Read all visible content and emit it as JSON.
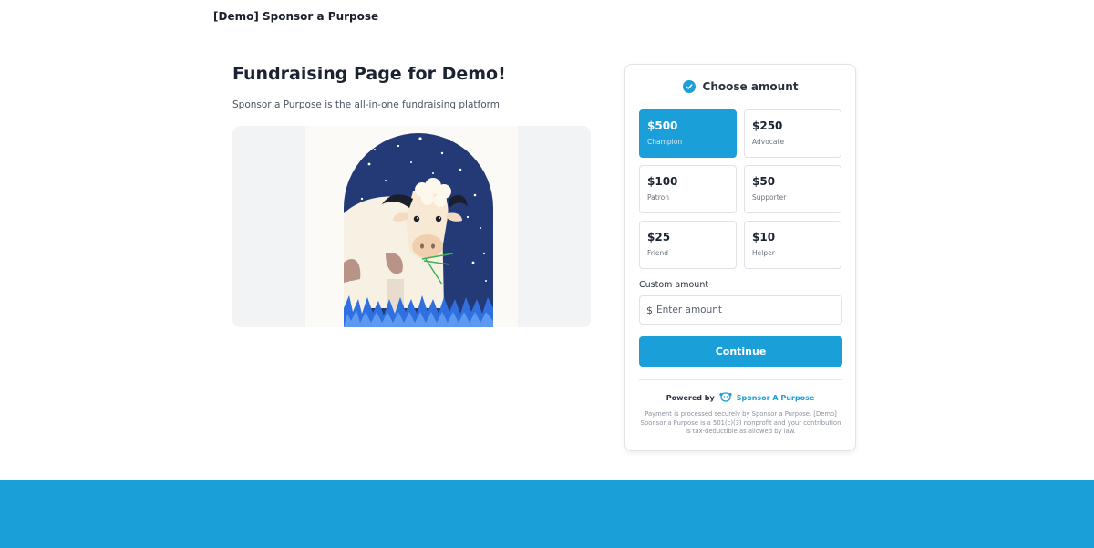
{
  "header": {
    "site_title": "[Demo] Sponsor a Purpose"
  },
  "main": {
    "title": "Fundraising Page for Demo!",
    "subtitle": "Sponsor a Purpose is the all-in-one fundraising platform",
    "image_subject": "illustrated cow grazing under a starry night sky"
  },
  "donation": {
    "heading": "Choose amount",
    "tiers": [
      {
        "amount": "$500",
        "name": "Champion",
        "selected": true
      },
      {
        "amount": "$250",
        "name": "Advocate",
        "selected": false
      },
      {
        "amount": "$100",
        "name": "Patron",
        "selected": false
      },
      {
        "amount": "$50",
        "name": "Supporter",
        "selected": false
      },
      {
        "amount": "$25",
        "name": "Friend",
        "selected": false
      },
      {
        "amount": "$10",
        "name": "Helper",
        "selected": false
      }
    ],
    "custom_label": "Custom amount",
    "currency_symbol": "$",
    "custom_placeholder": "Enter amount",
    "continue_label": "Continue",
    "powered_by": "Powered by",
    "brand": "Sponsor A Purpose",
    "legal": "Payment is processed securely by Sponsor a Purpose. [Demo] Sponsor a Purpose is a 501(c)(3) nonprofit and your contribution is tax-deductible as allowed by law."
  },
  "colors": {
    "accent": "#1a9fd9",
    "night_sky": "#243a76",
    "grass": "#2f6fe0",
    "footer": "#1a9fd9"
  }
}
